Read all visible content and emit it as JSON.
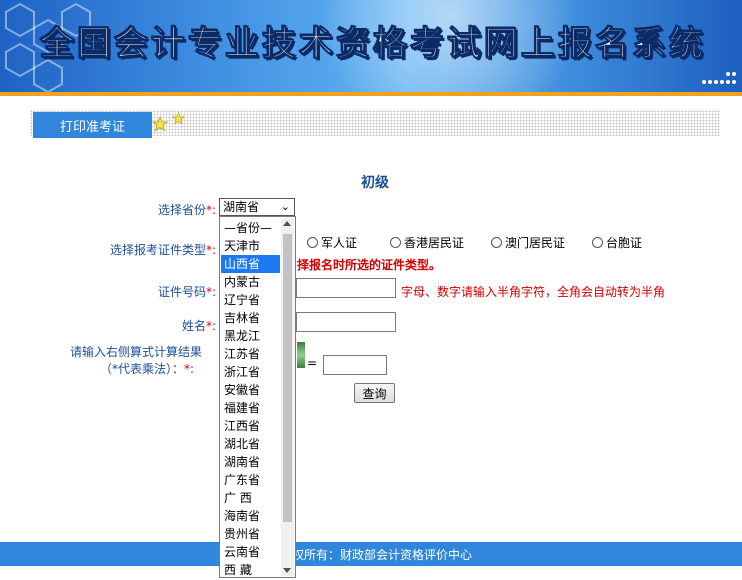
{
  "header": {
    "title": "全国会计专业技术资格考试网上报名系统"
  },
  "tabs": {
    "print_admission": "打印准考证"
  },
  "form": {
    "level": "初级",
    "province_label": "选择省份",
    "required_mark": "*:",
    "province_selected": "湖南省",
    "id_type_label": "选择报考证件类型",
    "id_type_options": [
      "军人证",
      "香港居民证",
      "澳门居民证",
      "台胞证"
    ],
    "id_type_hint": "择报名时所选的证件类型。",
    "id_number_label": "证件号码",
    "id_number_hint": "字母、数字请输入半角字符，全角会自动转为半角",
    "name_label": "姓名",
    "captcha_label_line1": "请输入右侧算式计算结果",
    "captcha_label_line2": "（*代表乘法）：",
    "captcha_required": "*:",
    "equals": "=",
    "query_button": "查询"
  },
  "dropdown": {
    "options": [
      "—省份—",
      "天津市",
      "山西省",
      "内蒙古",
      "辽宁省",
      "吉林省",
      "黑龙江",
      "江苏省",
      "浙江省",
      "安徽省",
      "福建省",
      "江西省",
      "湖北省",
      "湖南省",
      "广东省",
      "广 西",
      "海南省",
      "贵州省",
      "云南省",
      "西 藏"
    ],
    "highlighted": "山西省"
  },
  "footer": {
    "text": "权所有：财政部会计资格评价中心"
  },
  "colors": {
    "accent_blue": "#2f86da",
    "banner_orange": "#f0a11e",
    "required_red": "#e00000",
    "highlight": "#1e78f0"
  }
}
